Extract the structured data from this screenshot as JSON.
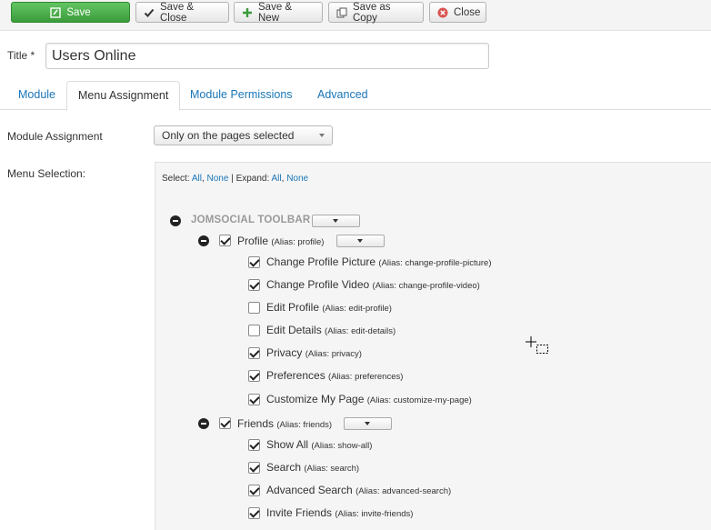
{
  "toolbar": {
    "save": "Save",
    "save_close": "Save & Close",
    "save_new": "Save & New",
    "save_copy": "Save as Copy",
    "close": "Close"
  },
  "title": {
    "label": "Title *",
    "value": "Users Online"
  },
  "tabs": [
    {
      "label": "Module"
    },
    {
      "label": "Menu Assignment"
    },
    {
      "label": "Module Permissions"
    },
    {
      "label": "Advanced"
    }
  ],
  "module_assignment": {
    "label": "Module Assignment",
    "selected": "Only on the pages selected"
  },
  "menu_selection": {
    "label": "Menu Selection:",
    "select_prefix": "Select:",
    "all": "All",
    "comma": ",",
    "none": "None",
    "separator": "|",
    "expand_prefix": "Expand:",
    "expand_all": "All",
    "expand_none": "None"
  },
  "tree": {
    "root": "JOMSOCIAL TOOLBAR",
    "groups": [
      {
        "label": "Profile",
        "alias": "(Alias: profile)",
        "checked": true,
        "items": [
          {
            "label": "Change Profile Picture",
            "alias": "(Alias: change-profile-picture)",
            "checked": true
          },
          {
            "label": "Change Profile Video",
            "alias": "(Alias: change-profile-video)",
            "checked": true
          },
          {
            "label": "Edit Profile",
            "alias": "(Alias: edit-profile)",
            "checked": false
          },
          {
            "label": "Edit Details",
            "alias": "(Alias: edit-details)",
            "checked": false
          },
          {
            "label": "Privacy",
            "alias": "(Alias: privacy)",
            "checked": true
          },
          {
            "label": "Preferences",
            "alias": "(Alias: preferences)",
            "checked": true
          },
          {
            "label": "Customize My Page",
            "alias": "(Alias: customize-my-page)",
            "checked": true
          }
        ]
      },
      {
        "label": "Friends",
        "alias": "(Alias: friends)",
        "checked": true,
        "items": [
          {
            "label": "Show All",
            "alias": "(Alias: show-all)",
            "checked": true
          },
          {
            "label": "Search",
            "alias": "(Alias: search)",
            "checked": true
          },
          {
            "label": "Advanced Search",
            "alias": "(Alias: advanced-search)",
            "checked": true
          },
          {
            "label": "Invite Friends",
            "alias": "(Alias: invite-friends)",
            "checked": true
          }
        ]
      }
    ]
  },
  "colors": {
    "link": "#1a76b8",
    "save_green": "#4cae4c",
    "close_red": "#d9534f"
  }
}
